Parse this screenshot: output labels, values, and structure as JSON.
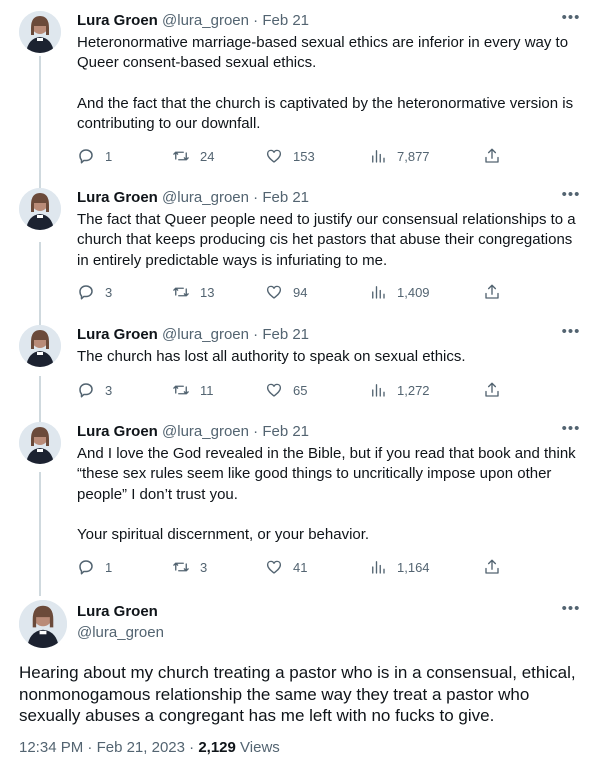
{
  "author": {
    "name": "Lura Groen",
    "handle": "@lura_groen"
  },
  "separator": "·",
  "more_label": "•••",
  "thread": [
    {
      "date": "Feb 21",
      "paragraphs": [
        "Heteronormative marriage-based sexual ethics are inferior in every way to Queer consent-based sexual ethics.",
        "And the fact that the church is captivated by the heteronormative version is contributing to our downfall."
      ],
      "replies": "1",
      "retweets": "24",
      "likes": "153",
      "views": "7,877"
    },
    {
      "date": "Feb 21",
      "paragraphs": [
        "The fact that Queer people need to justify our consensual relationships to a church that keeps producing cis het pastors that abuse their congregations in entirely predictable ways is infuriating to me."
      ],
      "replies": "3",
      "retweets": "13",
      "likes": "94",
      "views": "1,409"
    },
    {
      "date": "Feb 21",
      "paragraphs": [
        "The church has lost all authority to speak on sexual ethics."
      ],
      "replies": "3",
      "retweets": "11",
      "likes": "65",
      "views": "1,272"
    },
    {
      "date": "Feb 21",
      "paragraphs": [
        "And I love the God revealed in the Bible, but if you read that book and think “these sex rules seem like good things to uncritically impose upon other people” I don’t trust you.",
        "Your spiritual discernment, or your behavior."
      ],
      "replies": "1",
      "retweets": "3",
      "likes": "41",
      "views": "1,164"
    }
  ],
  "main_tweet": {
    "text": "Hearing about my church treating a pastor who is in a consensual, ethical, nonmonogamous relationship the same way they treat a pastor who sexually abuses a congregant has me left with no fucks to give.",
    "time": "12:34 PM",
    "date": "Feb 21, 2023",
    "views_count": "2,129",
    "views_label": "Views"
  },
  "icons": {
    "reply": "reply-icon",
    "retweet": "retweet-icon",
    "like": "like-icon",
    "views": "views-icon",
    "share": "share-icon",
    "more": "more-icon"
  },
  "colors": {
    "text": "#0f1419",
    "secondary": "#536471",
    "thread_line": "#cfd9de"
  }
}
